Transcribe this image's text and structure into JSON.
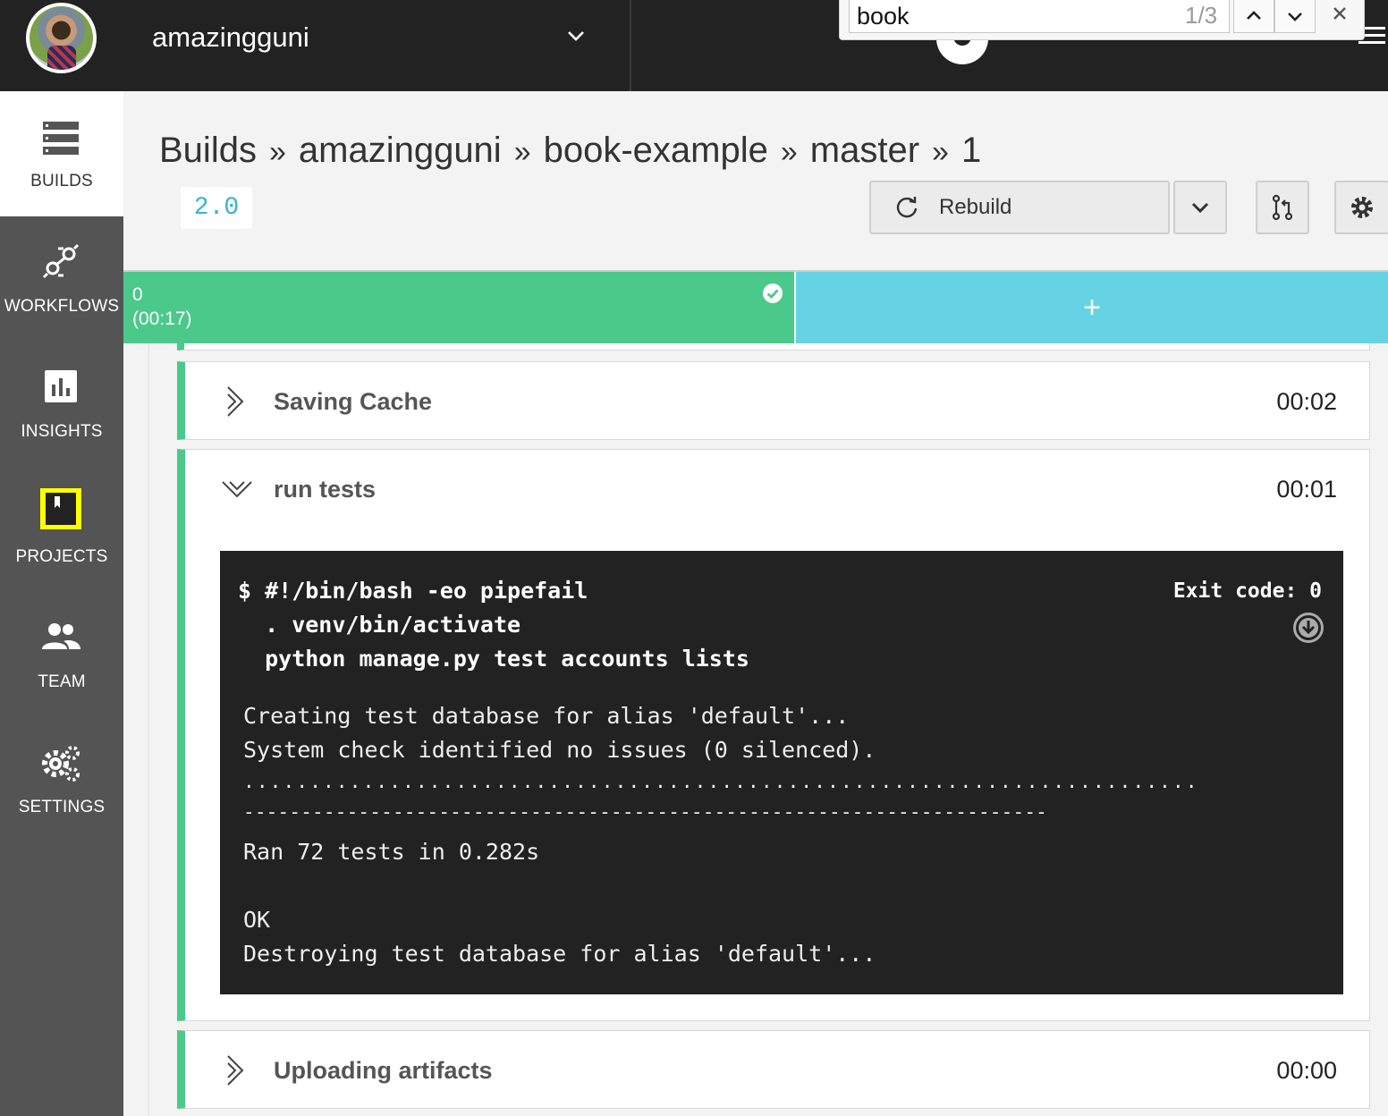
{
  "topbar": {
    "org_name": "amazingguni"
  },
  "findbar": {
    "query": "book",
    "count": "1/3"
  },
  "sidebar": {
    "items": [
      {
        "label": "BUILDS",
        "icon": "builds-icon",
        "active": true
      },
      {
        "label": "WORKFLOWS",
        "icon": "workflows-icon"
      },
      {
        "label": "INSIGHTS",
        "icon": "insights-icon"
      },
      {
        "label": "PROJECTS",
        "icon": "projects-icon"
      },
      {
        "label": "TEAM",
        "icon": "team-icon"
      },
      {
        "label": "SETTINGS",
        "icon": "settings-icon"
      }
    ]
  },
  "header": {
    "breadcrumb": [
      "Builds",
      "amazingguni",
      "book-example",
      "master",
      "1"
    ],
    "separator": "»",
    "version": "2.0",
    "rebuild_label": "Rebuild"
  },
  "containers": {
    "active": {
      "index": "0",
      "duration": "(00:17)",
      "status": "success"
    },
    "add_label": "+"
  },
  "steps": [
    {
      "title": "Saving Cache",
      "time": "00:02",
      "expanded": false
    },
    {
      "title": "run tests",
      "time": "00:01",
      "expanded": true
    },
    {
      "title": "Uploading artifacts",
      "time": "00:00",
      "expanded": false
    }
  ],
  "terminal": {
    "command_lines": [
      "$ #!/bin/bash -eo pipefail",
      "  . venv/bin/activate",
      "  python manage.py test accounts lists"
    ],
    "exit_code": "Exit code: 0",
    "output_lines": [
      "Creating test database for alias 'default'...",
      "System check identified no issues (0 silenced).",
      "........................................................................",
      "----------------------------------------------------------------------",
      "Ran 72 tests in 0.282s",
      "OK",
      "Destroying test database for alias 'default'..."
    ]
  },
  "colors": {
    "success": "#4ac98b",
    "add_container": "#66d3e4",
    "topbar": "#222222",
    "sidebar": "#545454",
    "projects_highlight": "#ffff00"
  }
}
